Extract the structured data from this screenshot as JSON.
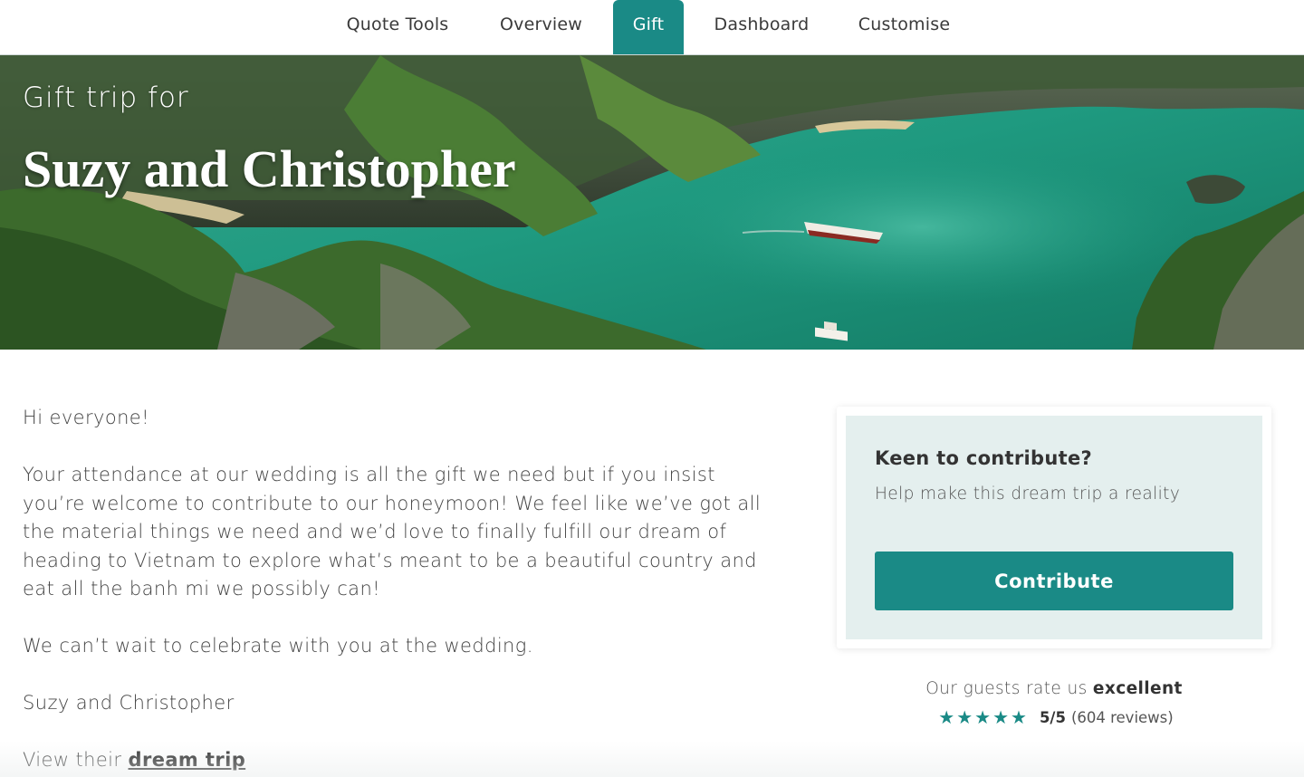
{
  "nav": {
    "tabs": [
      {
        "label": "Quote Tools",
        "active": false
      },
      {
        "label": "Overview",
        "active": false
      },
      {
        "label": "Gift",
        "active": true
      },
      {
        "label": "Dashboard",
        "active": false
      },
      {
        "label": "Customise",
        "active": false
      }
    ]
  },
  "hero": {
    "kicker": "Gift trip for",
    "title": "Suzy and Christopher"
  },
  "message": {
    "greeting": "Hi everyone!",
    "body": "Your attendance at our wedding is all the gift we need but if you insist you’re welcome to contribute to our honeymoon! We feel like we’ve got all the material things we need and we’d love to finally fulfill our dream of heading to Vietnam to explore what’s meant to be a beautiful country and eat all the banh mi we possibly can!",
    "closing": "We can’t wait to celebrate with you at the wedding.",
    "signature": "Suzy and Christopher",
    "view_prefix": "View their",
    "view_link": "dream trip"
  },
  "contribute_card": {
    "title": "Keen to contribute?",
    "subtitle": "Help make this dream trip a reality",
    "button": "Contribute"
  },
  "rating": {
    "prefix": "Our guests rate us",
    "word": "excellent",
    "stars": 5,
    "score": "5/5",
    "reviews": "(604 reviews)"
  },
  "colors": {
    "accent": "#1a8a86",
    "card_bg": "#e4efee"
  }
}
